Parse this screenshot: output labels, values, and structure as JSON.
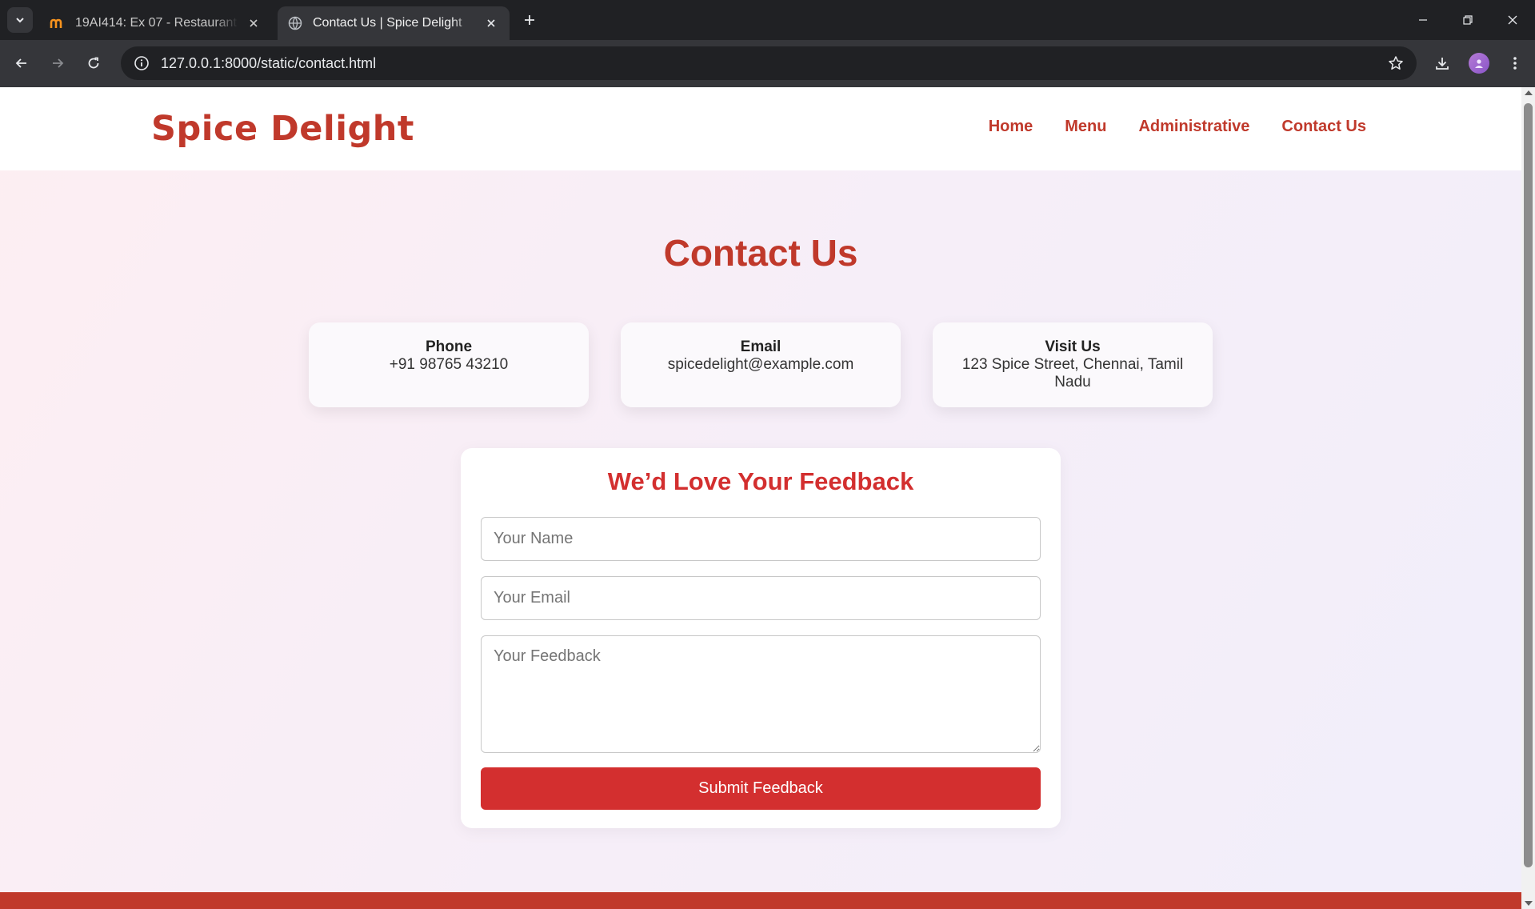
{
  "browser": {
    "tabs": [
      {
        "title": "19AI414: Ex 07 - Restaurant Website",
        "active": false,
        "favicon": "moodle-icon"
      },
      {
        "title": "Contact Us | Spice Delight",
        "active": true,
        "favicon": "globe-icon"
      }
    ],
    "address": "127.0.0.1:8000/static/contact.html"
  },
  "site": {
    "logo": "Spice Delight",
    "nav": [
      {
        "label": "Home"
      },
      {
        "label": "Menu"
      },
      {
        "label": "Administrative"
      },
      {
        "label": "Contact Us"
      }
    ]
  },
  "page": {
    "title": "Contact Us",
    "cards": [
      {
        "heading": "Phone",
        "text": "+91 98765 43210"
      },
      {
        "heading": "Email",
        "text": "spicedelight@example.com"
      },
      {
        "heading": "Visit Us",
        "text": "123 Spice Street, Chennai, Tamil Nadu"
      }
    ],
    "feedback": {
      "heading": "We’d Love Your Feedback",
      "name_placeholder": "Your Name",
      "email_placeholder": "Your Email",
      "feedback_placeholder": "Your Feedback",
      "submit_label": "Submit Feedback"
    }
  },
  "colors": {
    "brand": "#c0392b",
    "button": "#d32f2f"
  }
}
